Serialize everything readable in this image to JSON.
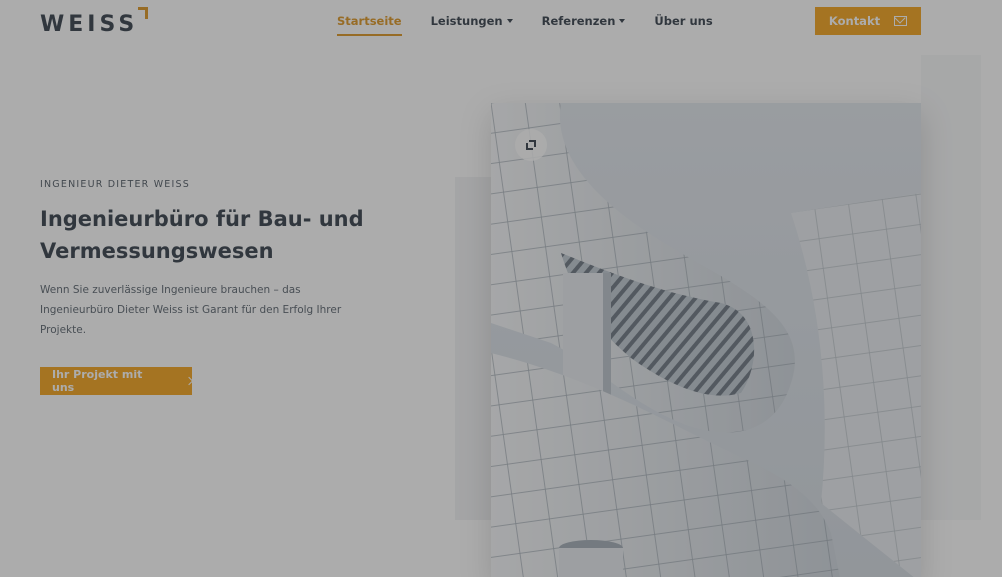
{
  "header": {
    "logo_text": "WEISS",
    "nav": [
      {
        "label": "Startseite",
        "active": true,
        "has_dropdown": false
      },
      {
        "label": "Leistungen",
        "active": false,
        "has_dropdown": true
      },
      {
        "label": "Referenzen",
        "active": false,
        "has_dropdown": true
      },
      {
        "label": "Über uns",
        "active": false,
        "has_dropdown": false
      }
    ],
    "contact_label": "Kontakt",
    "contact_icon": "mail-icon"
  },
  "hero": {
    "eyebrow": "INGENIEUR DIETER WEISS",
    "headline": "Ingenieurbüro für Bau- und Vermessungswesen",
    "lead": "Wenn Sie zuverlässige Ingenieure brauchen – das Ingenieurbüro Dieter Weiss ist Garant für den Erfolg Ihrer Projekte.",
    "cta_label": "Ihr Projekt mit uns",
    "cta_icon": "chevron-right-icon",
    "image_icon": "expand-icon"
  },
  "colors": {
    "accent": "#f29a05",
    "text_dark": "#1f2b38",
    "overlay": "#464646"
  }
}
